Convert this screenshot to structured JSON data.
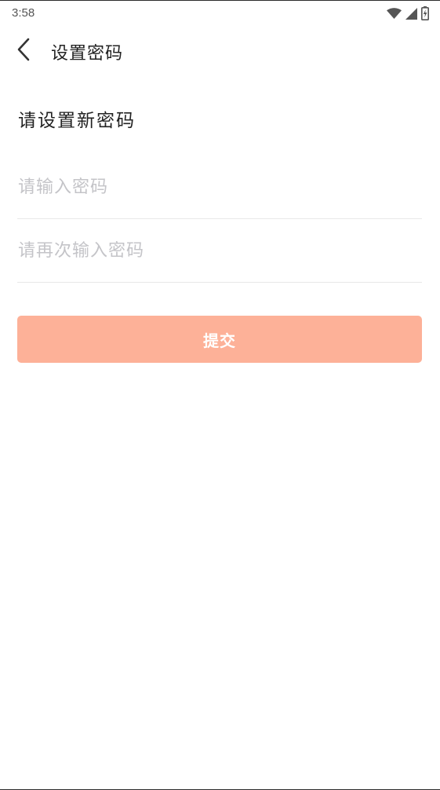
{
  "status_bar": {
    "time": "3:58",
    "icons": [
      "wifi-icon",
      "cellular-signal-icon",
      "battery-charging-icon"
    ]
  },
  "header": {
    "back_icon": "chevron-left-icon",
    "title": "设置密码"
  },
  "form": {
    "section_title": "请设置新密码",
    "password": {
      "placeholder": "请输入密码",
      "value": ""
    },
    "confirm_password": {
      "placeholder": "请再次输入密码",
      "value": ""
    },
    "submit_label": "提交"
  },
  "colors": {
    "background": "#ffffff",
    "submit_button": "#fdb198",
    "title_text": "#222222",
    "placeholder_text": "#c4c4c8",
    "divider": "#e8e8e8"
  }
}
